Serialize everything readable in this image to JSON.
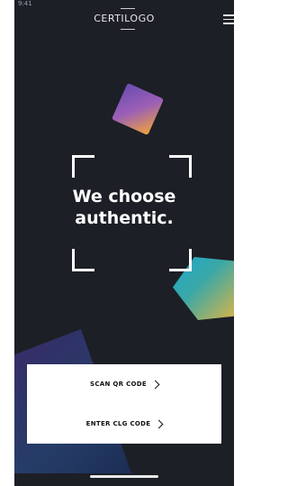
{
  "app": {
    "logo_text": "CERTILOGO",
    "status_time": "9:41"
  },
  "header": {
    "menu_icon": "hamburger-menu-icon"
  },
  "hero": {
    "line1": "We choose",
    "line2": "authentic."
  },
  "actions": {
    "scan_label": "SCAN QR CODE",
    "enter_label": "ENTER CLG CODE"
  },
  "colors": {
    "background": "#1c1f26",
    "panel": "#ffffff",
    "text_light": "#ffffff",
    "text_dark": "#111111"
  }
}
